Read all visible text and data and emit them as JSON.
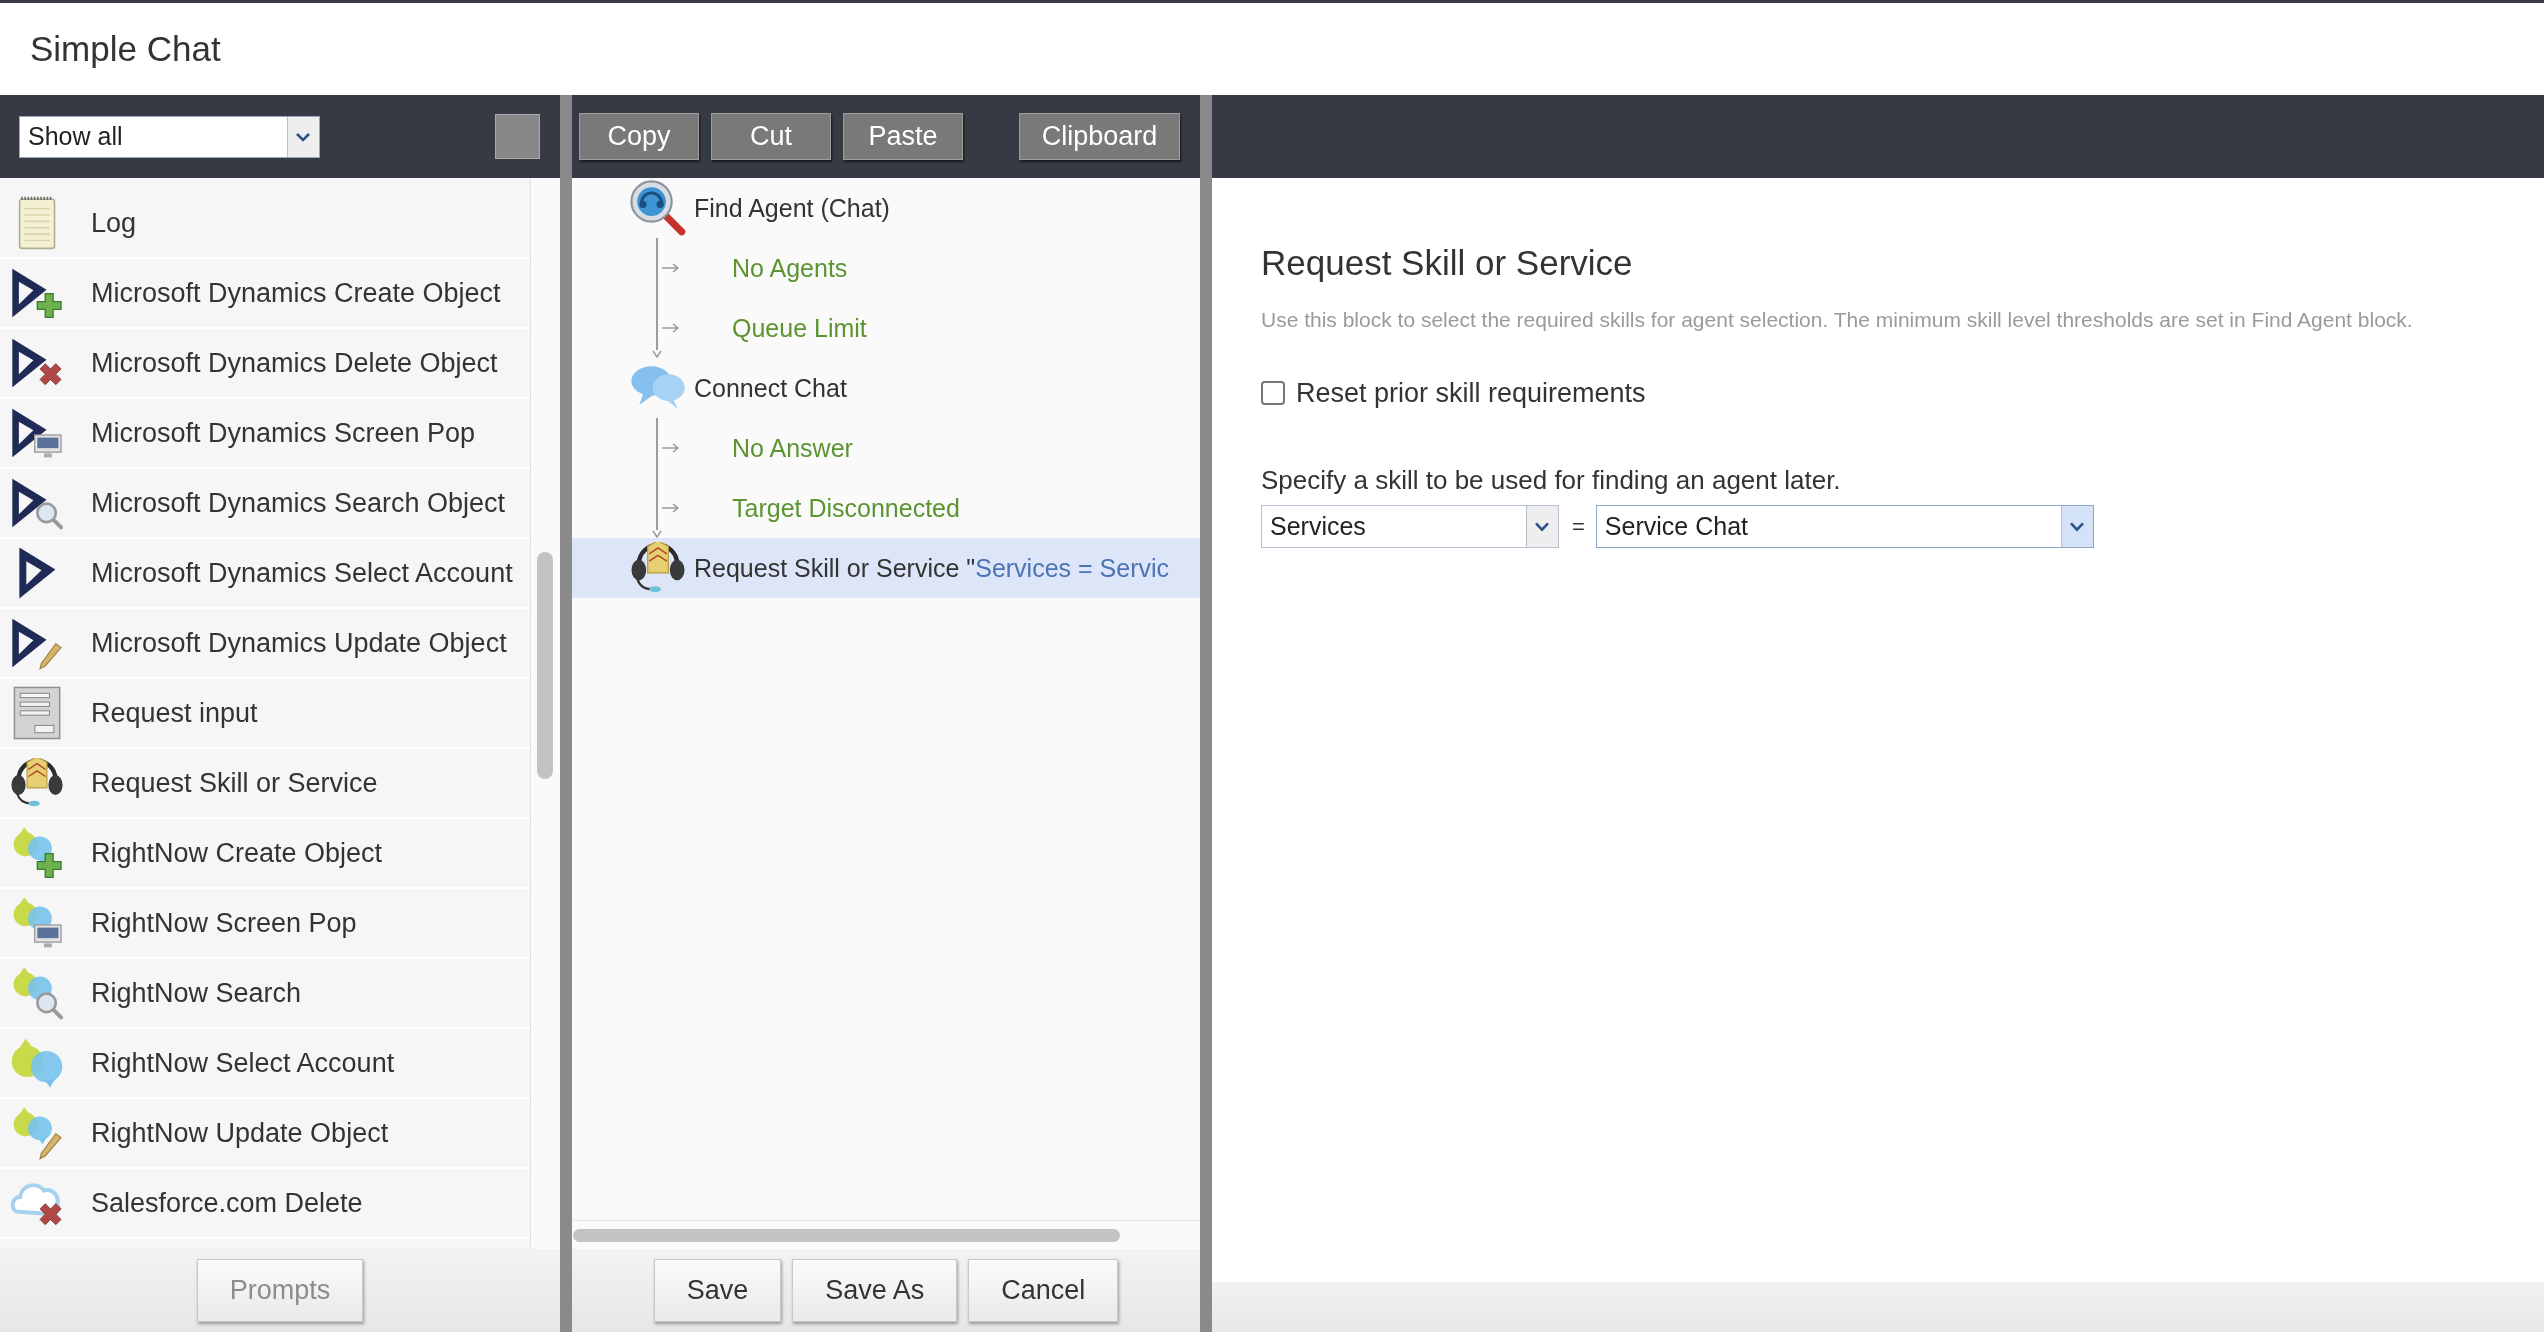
{
  "window": {
    "title": "Simple Chat"
  },
  "palette": {
    "filter": {
      "value": "Show all"
    },
    "items": [
      {
        "label": "Log",
        "kind": "log"
      },
      {
        "label": "Microsoft Dynamics Create Object",
        "kind": "dynamics-create"
      },
      {
        "label": "Microsoft Dynamics Delete Object",
        "kind": "dynamics-delete"
      },
      {
        "label": "Microsoft Dynamics Screen Pop",
        "kind": "dynamics-screenpop"
      },
      {
        "label": "Microsoft Dynamics Search Object",
        "kind": "dynamics-search"
      },
      {
        "label": "Microsoft Dynamics Select Account",
        "kind": "dynamics-select"
      },
      {
        "label": "Microsoft Dynamics Update Object",
        "kind": "dynamics-update"
      },
      {
        "label": "Request input",
        "kind": "input"
      },
      {
        "label": "Request Skill or Service",
        "kind": "skill"
      },
      {
        "label": "RightNow Create Object",
        "kind": "rightnow-create"
      },
      {
        "label": "RightNow Screen Pop",
        "kind": "rightnow-screenpop"
      },
      {
        "label": "RightNow Search",
        "kind": "rightnow-search"
      },
      {
        "label": "RightNow Select Account",
        "kind": "rightnow-select"
      },
      {
        "label": "RightNow Update Object",
        "kind": "rightnow-update"
      },
      {
        "label": "Salesforce.com Delete",
        "kind": "salesforce-delete"
      }
    ],
    "buttons": [
      {
        "label": "Prompts",
        "disabled": true
      }
    ]
  },
  "toolbar": {
    "buttons": [
      "Copy",
      "Cut",
      "Paste"
    ],
    "clipboard": "Clipboard"
  },
  "flow": {
    "blocks": [
      {
        "label": "Find Agent (Chat)",
        "kind": "find-agent",
        "selected": false,
        "exits": [
          "No Agents",
          "Queue Limit"
        ]
      },
      {
        "label": "Connect Chat",
        "kind": "chat",
        "selected": false,
        "exits": [
          "No Answer",
          "Target Disconnected"
        ]
      },
      {
        "label": "Request Skill or Service \"",
        "summary": "Services = Servic",
        "kind": "skill",
        "selected": true
      }
    ],
    "buttons": [
      {
        "label": "Save",
        "disabled": false
      },
      {
        "label": "Save As",
        "disabled": false
      },
      {
        "label": "Cancel",
        "disabled": false
      }
    ]
  },
  "properties": {
    "title": "Request Skill or Service",
    "description": "Use this block to select the required skills for agent selection. The minimum skill level thresholds are set in Find Agent block.",
    "reset": {
      "label": "Reset prior skill requirements",
      "checked": false
    },
    "skill_prompt": "Specify a skill to be used for finding an agent later.",
    "skill": [
      {
        "value": "Services",
        "focused": false
      },
      {
        "value": "Service Chat",
        "focused": true
      }
    ],
    "operator": "="
  }
}
